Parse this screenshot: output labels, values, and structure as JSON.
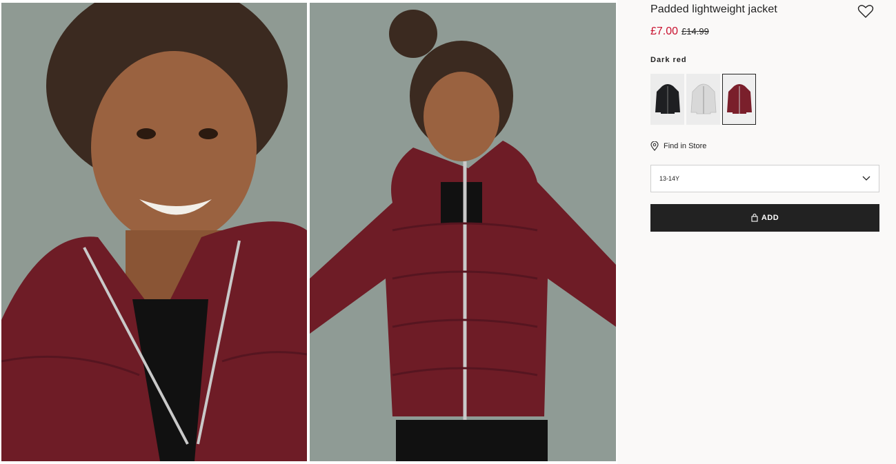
{
  "product": {
    "title": "Padded lightweight jacket",
    "price_sale": "£7.00",
    "price_old": "£14.99",
    "sale_color": "#c8102e"
  },
  "color": {
    "label": "Dark red",
    "swatches": [
      {
        "name": "black",
        "color": "#1e1f22"
      },
      {
        "name": "light grey",
        "color": "#d8d8d8"
      },
      {
        "name": "dark red",
        "color": "#7a1f2b",
        "selected": true
      }
    ]
  },
  "store": {
    "label": "Find in Store",
    "icon": "location-pin-icon"
  },
  "size": {
    "selected": "13-14Y",
    "icon": "chevron-down-icon"
  },
  "add_button": {
    "label": "ADD",
    "icon": "shopping-bag-icon"
  },
  "favourite": {
    "icon": "heart-icon"
  },
  "gallery": {
    "images": [
      {
        "subject": "child-closeup-jacket"
      },
      {
        "subject": "child-full-jacket"
      }
    ],
    "jacket_color": "#6e1c26",
    "background_color": "#8f9b95"
  }
}
